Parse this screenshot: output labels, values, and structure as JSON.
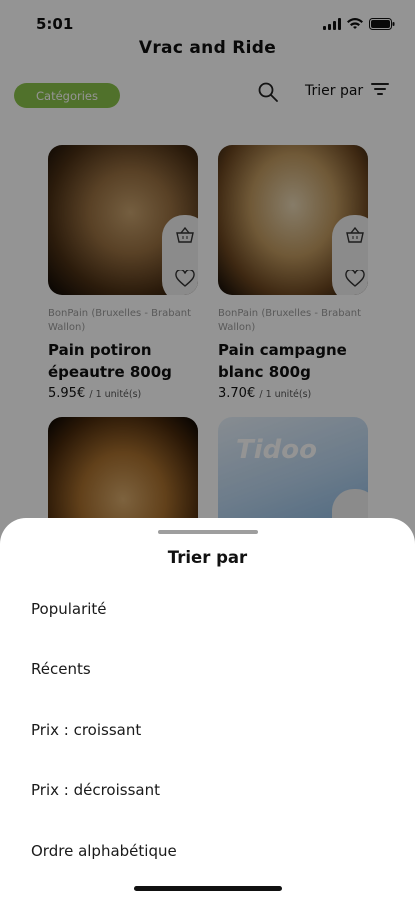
{
  "status": {
    "time": "5:01"
  },
  "header": {
    "title": "Vrac and Ride"
  },
  "toolbar": {
    "categories_label": "Catégories",
    "sort_label": "Trier par"
  },
  "products": [
    {
      "seller": "BonPain (Bruxelles - Brabant Wallon)",
      "name": "Pain potiron épeautre 800g",
      "price": "5.95€",
      "unit": "/ 1 unité(s)"
    },
    {
      "seller": "BonPain (Bruxelles - Brabant Wallon)",
      "name": "Pain campagne blanc 800g",
      "price": "3.70€",
      "unit": "/ 1 unité(s)"
    },
    {
      "brand": "Tidoo"
    }
  ],
  "sort_sheet": {
    "title": "Trier par",
    "options": [
      "Popularité",
      "Récents",
      "Prix : croissant",
      "Prix : décroissant",
      "Ordre alphabétique"
    ]
  },
  "colors": {
    "accent": "#8bc34a",
    "overlay": "rgba(0,0,0,0.42)"
  },
  "icons": [
    "wifi-icon",
    "battery-icon",
    "search-icon",
    "filter-icon",
    "basket-icon",
    "heart-icon"
  ]
}
